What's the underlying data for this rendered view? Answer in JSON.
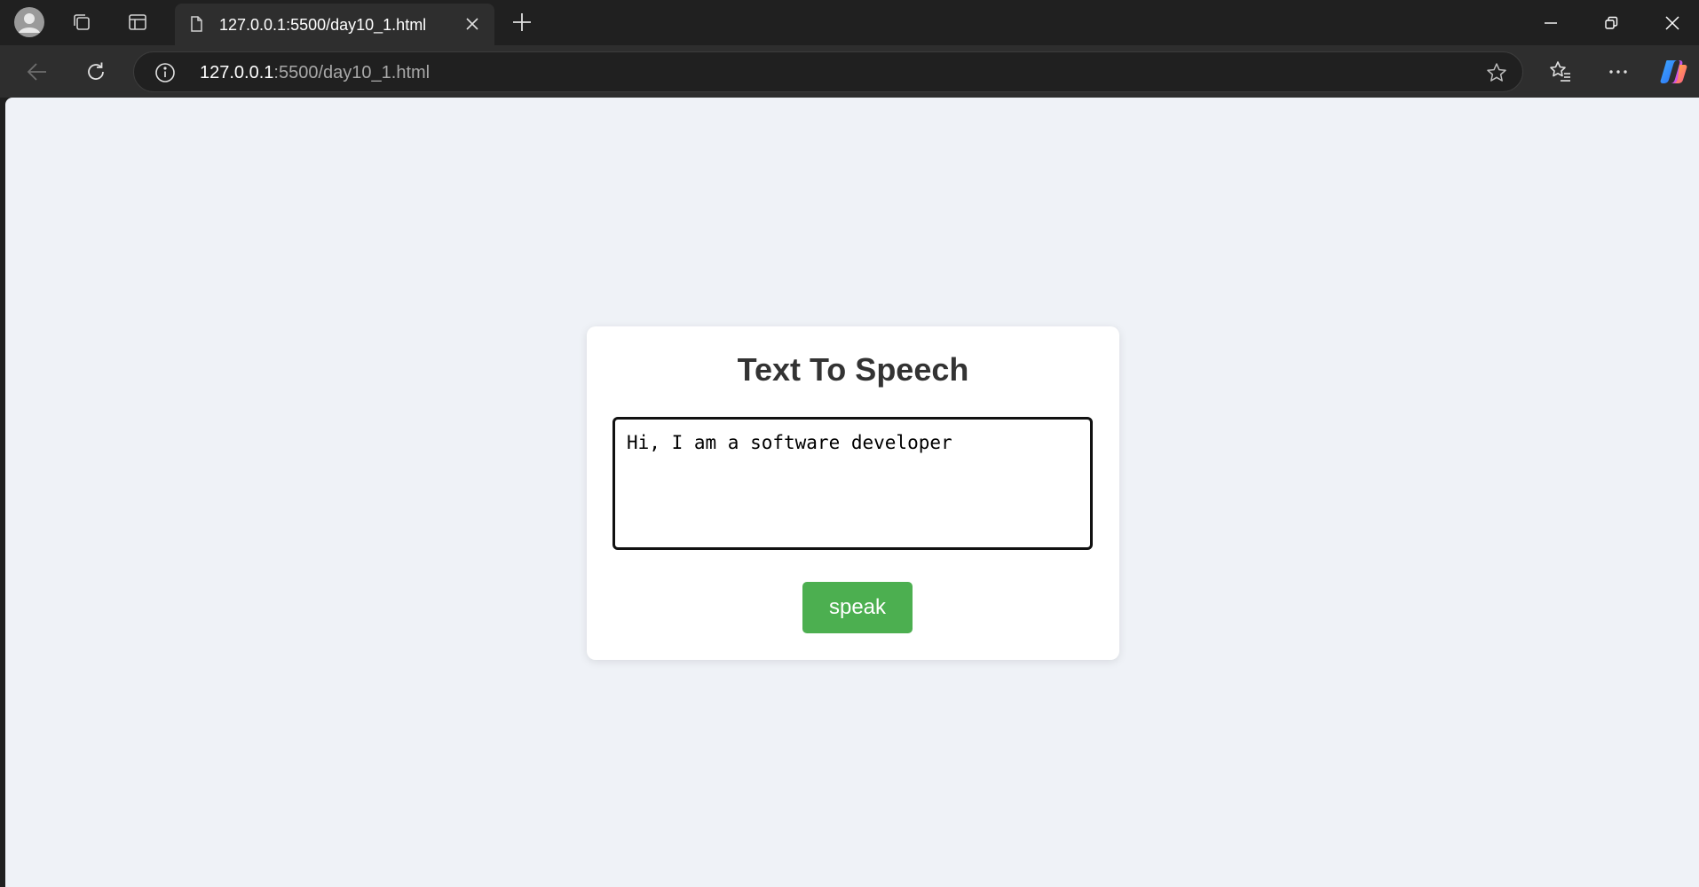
{
  "browser": {
    "tab": {
      "title": "127.0.0.1:5500/day10_1.html"
    },
    "address_bar": {
      "url_host": "127.0.0.1",
      "url_rest": ":5500/day10_1.html"
    },
    "icons": {
      "avatar": "avatar-icon",
      "workspaces": "workspaces-icon",
      "tab_actions": "tab-actions-icon",
      "favicon": "page-icon",
      "tab_close": "close-icon",
      "new_tab": "plus-icon",
      "minimize": "minimize-icon",
      "restore": "restore-icon",
      "window_close": "close-icon",
      "back": "arrow-left-icon",
      "reload": "reload-icon",
      "site_info": "info-icon",
      "favorite": "star-icon",
      "favorites": "favorites-icon",
      "more": "more-icon",
      "copilot": "copilot-icon"
    }
  },
  "page": {
    "title": "Text To Speech",
    "textarea_value": "Hi, I am a software developer",
    "speak_label": "speak",
    "colors": {
      "background": "#eff2f7",
      "card": "#ffffff",
      "button": "#4caf50",
      "title_text": "#333333"
    }
  }
}
